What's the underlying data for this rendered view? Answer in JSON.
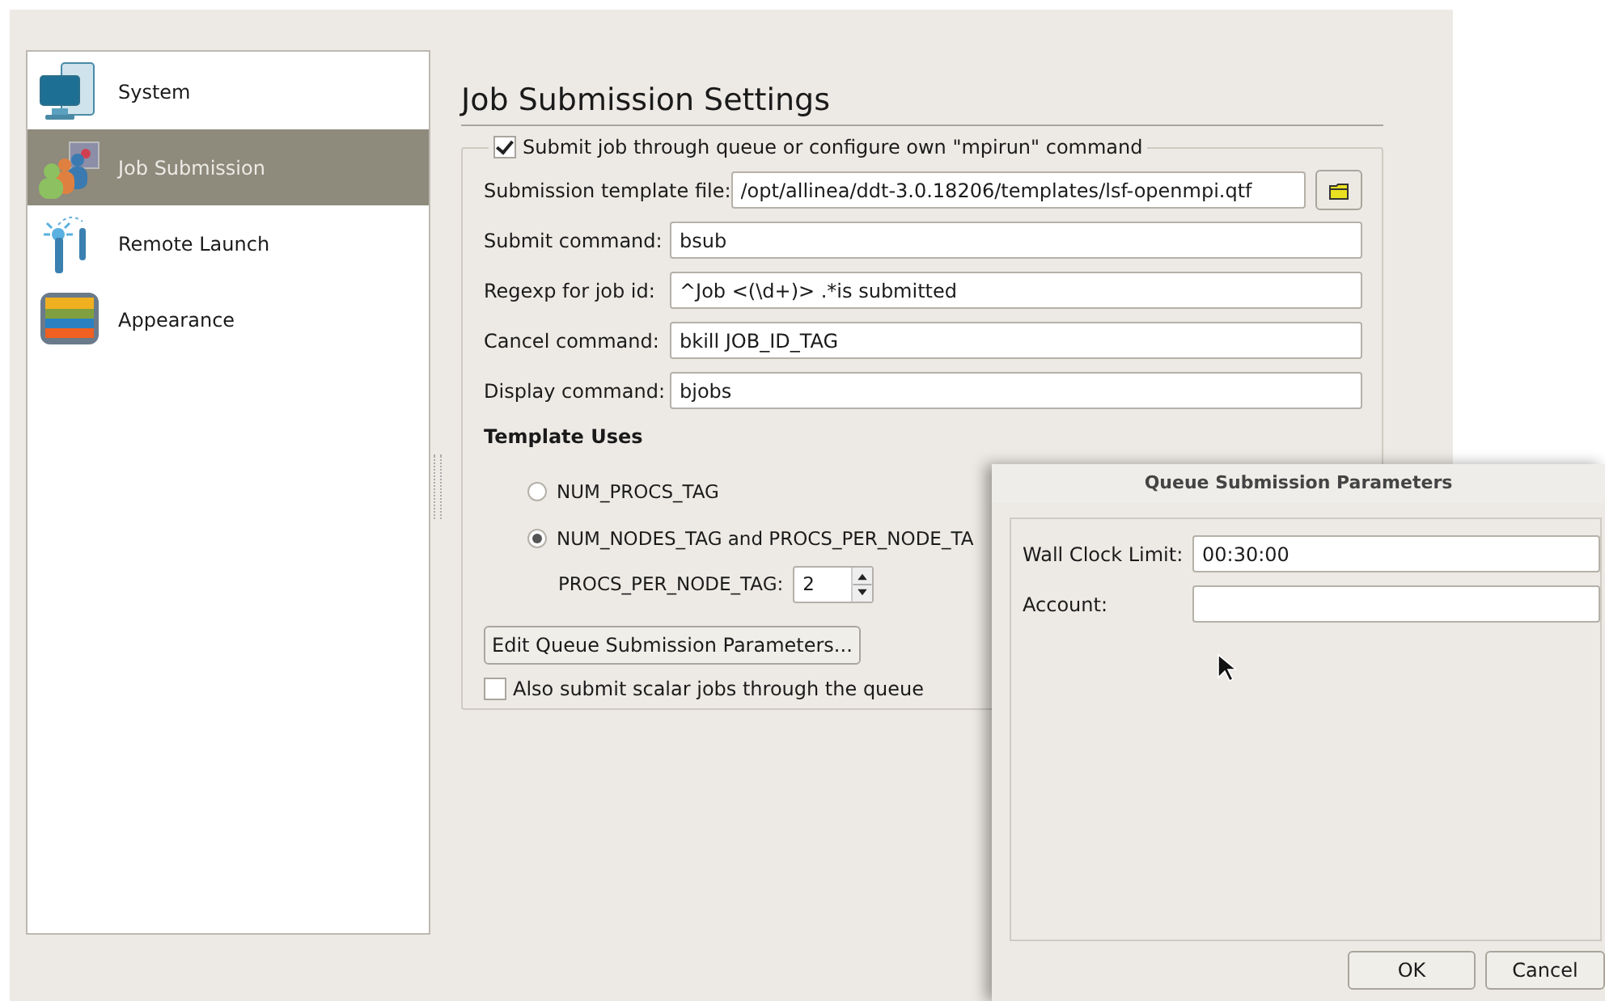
{
  "sidebar": {
    "items": [
      {
        "label": "System",
        "kind": "computer",
        "selected": false
      },
      {
        "label": "Job Submission",
        "kind": "people",
        "selected": true
      },
      {
        "label": "Remote Launch",
        "kind": "antenna",
        "selected": false
      },
      {
        "label": "Appearance",
        "kind": "palette",
        "selected": false
      }
    ]
  },
  "settings": {
    "title": "Job Submission Settings",
    "queue_checkbox": {
      "label": "Submit job through queue or configure own \"mpirun\" command",
      "checked": true
    },
    "fields": [
      {
        "label": "Submission template file:",
        "value": "/opt/allinea/ddt-3.0.18206/templates/lsf-openmpi.qtf",
        "browse": true
      },
      {
        "label": "Submit command:",
        "value": "bsub",
        "browse": false
      },
      {
        "label": "Regexp for job id:",
        "value": "^Job <(\\d+)> .*is submitted",
        "browse": false
      },
      {
        "label": "Cancel command:",
        "value": "bkill JOB_ID_TAG",
        "browse": false
      },
      {
        "label": "Display command:",
        "value": "bjobs",
        "browse": false
      }
    ],
    "template_uses": {
      "heading": "Template Uses",
      "options": [
        {
          "label": "NUM_PROCS_TAG",
          "selected": false
        },
        {
          "label": "NUM_NODES_TAG and PROCS_PER_NODE_TA",
          "selected": true
        }
      ],
      "spin": {
        "label": "PROCS_PER_NODE_TAG:",
        "value": "2"
      }
    },
    "edit_button": "Edit Queue Submission Parameters...",
    "scalar_checkbox": {
      "label": "Also submit scalar jobs through the queue",
      "checked": false
    }
  },
  "dialog": {
    "title": "Queue Submission Parameters",
    "fields": [
      {
        "label": "Wall Clock Limit:",
        "value": "00:30:00"
      },
      {
        "label": "Account:"
      }
    ],
    "buttons": [
      "OK",
      "Cancel"
    ]
  }
}
